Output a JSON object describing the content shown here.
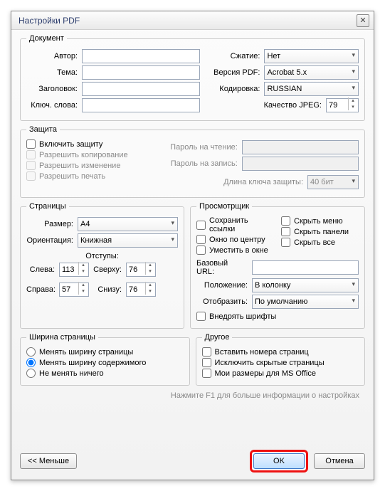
{
  "window": {
    "title": "Настройки PDF"
  },
  "document": {
    "legend": "Документ",
    "author_label": "Автор:",
    "author_value": "",
    "subject_label": "Тема:",
    "subject_value": "",
    "title_label": "Заголовок:",
    "title_value": "",
    "keywords_label": "Ключ. слова:",
    "keywords_value": "",
    "compression_label": "Сжатие:",
    "compression_value": "Нет",
    "pdfver_label": "Версия PDF:",
    "pdfver_value": "Acrobat 5.x",
    "encoding_label": "Кодировка:",
    "encoding_value": "RUSSIAN",
    "jpeg_label": "Качество JPEG:",
    "jpeg_value": "79"
  },
  "security": {
    "legend": "Защита",
    "enable": "Включить защиту",
    "allow_copy": "Разрешить копирование",
    "allow_edit": "Разрешить изменение",
    "allow_print": "Разрешить печать",
    "read_pw_label": "Пароль на чтение:",
    "write_pw_label": "Пароль на запись:",
    "keylen_label": "Длина ключа защиты:",
    "keylen_value": "40 бит"
  },
  "pages": {
    "legend": "Страницы",
    "size_label": "Размер:",
    "size_value": "A4",
    "orient_label": "Ориентация:",
    "orient_value": "Книжная",
    "margins_label": "Отступы:",
    "left_label": "Слева:",
    "left_value": "113",
    "top_label": "Сверху:",
    "top_value": "76",
    "right_label": "Справа:",
    "right_value": "57",
    "bottom_label": "Снизу:",
    "bottom_value": "76"
  },
  "viewer": {
    "legend": "Просмотрщик",
    "keep_links": "Сохранить ссылки",
    "hide_menu": "Скрыть меню",
    "center_window": "Окно по центру",
    "hide_panels": "Скрыть панели",
    "fit_window": "Уместить в окне",
    "hide_all": "Скрыть все",
    "baseurl_label": "Базовый URL:",
    "baseurl_value": "",
    "layout_label": "Положение:",
    "layout_value": "В колонку",
    "display_label": "Отобразить:",
    "display_value": "По умолчанию",
    "embed_fonts": "Внедрять шрифты"
  },
  "pagewidth": {
    "legend": "Ширина страницы",
    "change_page": "Менять ширину страницы",
    "change_content": "Менять ширину содержимого",
    "change_none": "Не менять ничего"
  },
  "other": {
    "legend": "Другое",
    "page_numbers": "Вставить номера страниц",
    "skip_hidden": "Исключить скрытые страницы",
    "ms_sizes": "Мои размеры для MS Office"
  },
  "hint": "Нажмите F1 для больше информации о настройках",
  "buttons": {
    "less": "<< Меньше",
    "ok": "OK",
    "cancel": "Отмена"
  }
}
